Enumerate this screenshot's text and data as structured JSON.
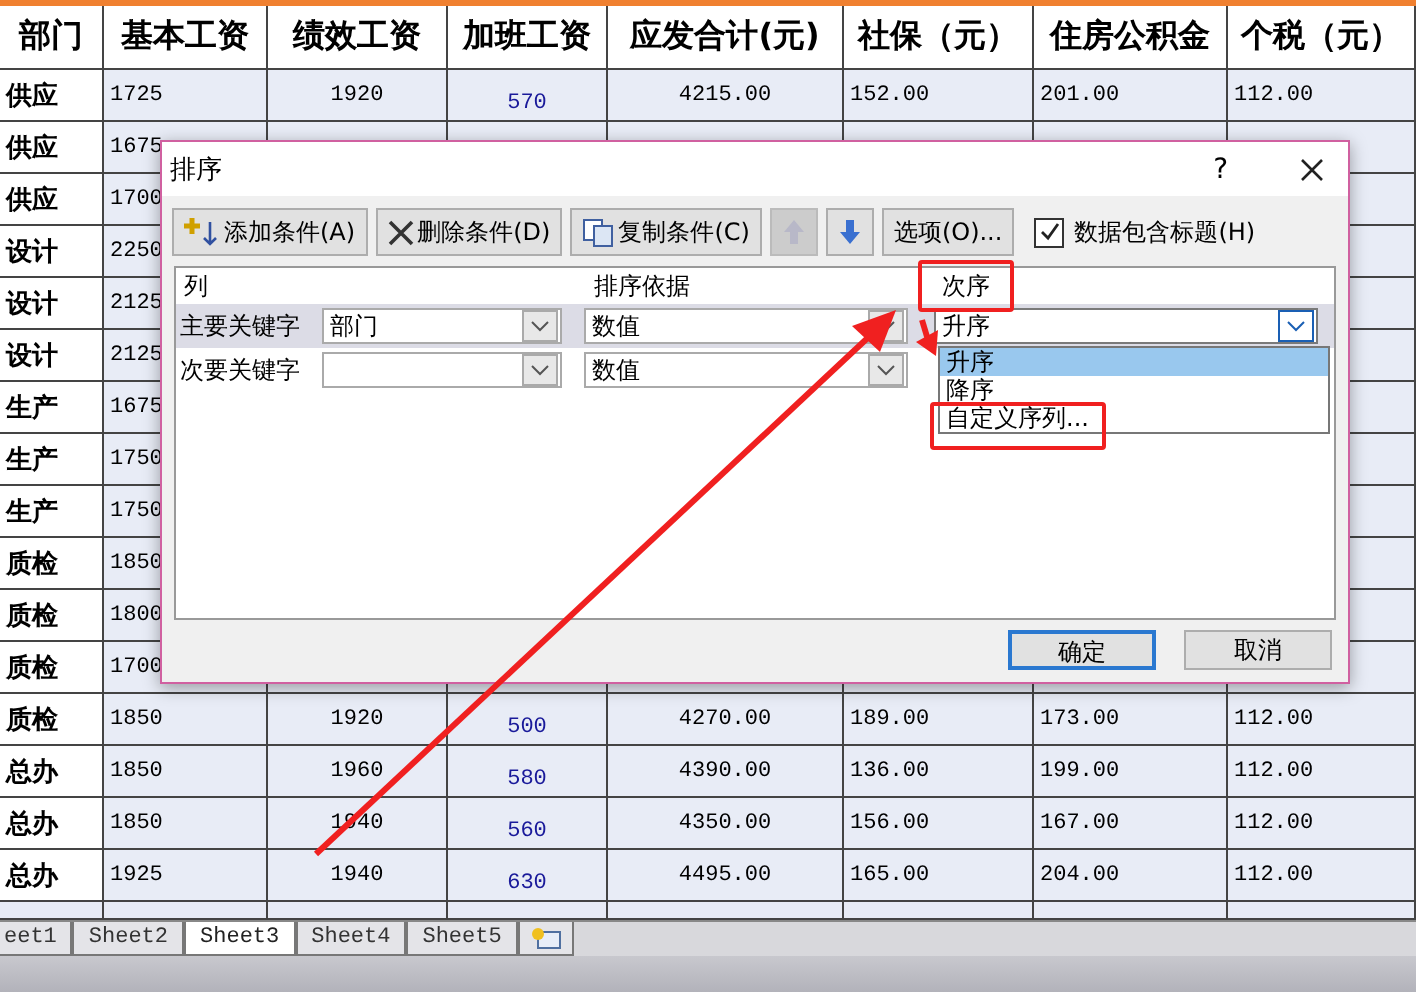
{
  "sheet": {
    "columns": [
      "部门",
      "基本工资",
      "绩效工资",
      "加班工资",
      "应发合计(元)",
      "社保（元）",
      "住房公积金",
      "个税（元）"
    ],
    "rows": [
      {
        "cells": [
          "供应",
          "1725",
          "1920",
          "570",
          "4215.00",
          "152.00",
          "201.00",
          "112.00"
        ]
      },
      {
        "cells": [
          "供应",
          "1675"
        ]
      },
      {
        "cells": [
          "供应",
          "1700"
        ]
      },
      {
        "cells": [
          "设计",
          "2250"
        ]
      },
      {
        "cells": [
          "设计",
          "2125"
        ]
      },
      {
        "cells": [
          "设计",
          "2125"
        ]
      },
      {
        "cells": [
          "生产",
          "1675"
        ]
      },
      {
        "cells": [
          "生产",
          "1750"
        ]
      },
      {
        "cells": [
          "生产",
          "1750"
        ]
      },
      {
        "cells": [
          "质检",
          "1850"
        ]
      },
      {
        "cells": [
          "质检",
          "1800"
        ]
      },
      {
        "cells": [
          "质检",
          "1700"
        ]
      },
      {
        "cells": [
          "质检",
          "1850",
          "1920",
          "500",
          "4270.00",
          "189.00",
          "173.00",
          "112.00"
        ]
      },
      {
        "cells": [
          "总办",
          "1850",
          "1960",
          "580",
          "4390.00",
          "136.00",
          "199.00",
          "112.00"
        ]
      },
      {
        "cells": [
          "总办",
          "1850",
          "1940",
          "560",
          "4350.00",
          "156.00",
          "167.00",
          "112.00"
        ]
      },
      {
        "cells": [
          "总办",
          "1925",
          "1940",
          "630",
          "4495.00",
          "165.00",
          "204.00",
          "112.00"
        ]
      }
    ],
    "tabs": [
      {
        "label": "eet1",
        "selected": false
      },
      {
        "label": "Sheet2",
        "selected": false
      },
      {
        "label": "Sheet3",
        "selected": true
      },
      {
        "label": "Sheet4",
        "selected": false
      },
      {
        "label": "Sheet5",
        "selected": false
      }
    ]
  },
  "dialog": {
    "title": "排序",
    "help": "?",
    "toolbar": [
      {
        "kind": "add",
        "label": "添加条件(A)"
      },
      {
        "kind": "delete",
        "label": "删除条件(D)"
      },
      {
        "kind": "copy",
        "label": "复制条件(C)"
      },
      {
        "kind": "up",
        "disabled": true
      },
      {
        "kind": "down",
        "disabled": false
      },
      {
        "kind": "text",
        "label": "选项(O)..."
      }
    ],
    "header_checkbox": {
      "label": "数据包含标题(H)",
      "checked": true
    },
    "headers": [
      "列",
      "排序依据",
      "次序"
    ],
    "levels": [
      {
        "label": "主要关键字",
        "column": "部门",
        "basis": "数值",
        "order": "升序",
        "selected": true
      },
      {
        "label": "次要关键字",
        "basis": "数值",
        "selected": false
      }
    ],
    "order_options": [
      {
        "label": "升序",
        "selected": true
      },
      {
        "label": "降序",
        "selected": false
      },
      {
        "label": "自定义序列...",
        "selected": false
      }
    ],
    "buttons": [
      {
        "label": "确定",
        "default": true
      },
      {
        "label": "取消",
        "default": false
      }
    ]
  }
}
